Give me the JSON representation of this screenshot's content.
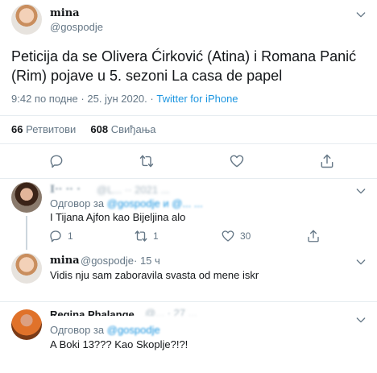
{
  "main": {
    "display_name": "mina",
    "handle": "@gospodje",
    "text": "Peticija da se Olivera Ćirković (Atina) i Romana Panić (Rim) pojave u 5. sezoni La casa de papel",
    "time": "9:42 по подне",
    "sep": "·",
    "date": "25. јун 2020.",
    "sep2": "·",
    "source": "Twitter for iPhone",
    "retweets_count": "66",
    "retweets_label": "Ретвитови",
    "likes_count": "608",
    "likes_label": "Свиђања"
  },
  "replies": [
    {
      "display_name": "I·· ·· ·",
      "handle_blur": "@L... ·· 2021 ...",
      "reply_to_label": "Одговор за",
      "reply_to_handle": "@gospodje и @... ...",
      "text": "I Tijana Ajfon kao Bijeljina alo",
      "reply_count": "1",
      "retweet_count": "1",
      "like_count": "30"
    },
    {
      "display_name": "mina",
      "handle": "@gospodje",
      "time": "· 15 ч",
      "text": "Vidis nju sam zaboravila svasta od mene iskr"
    },
    {
      "display_name": "Regina Phalange",
      "handle_blur": "@... · 27 ...",
      "reply_to_label": "Одговор за",
      "reply_to_handle": "@gospodje",
      "text": "A Boki 13??? Kao Skoplje?!?!"
    }
  ],
  "icons": {
    "reply": "reply-icon",
    "retweet": "retweet-icon",
    "like": "heart-icon",
    "share": "share-icon",
    "more": "chevron-down-icon"
  },
  "colors": {
    "link": "#1b95e0",
    "muted": "#657786",
    "text": "#14171a",
    "divider": "#e6ecf0"
  }
}
